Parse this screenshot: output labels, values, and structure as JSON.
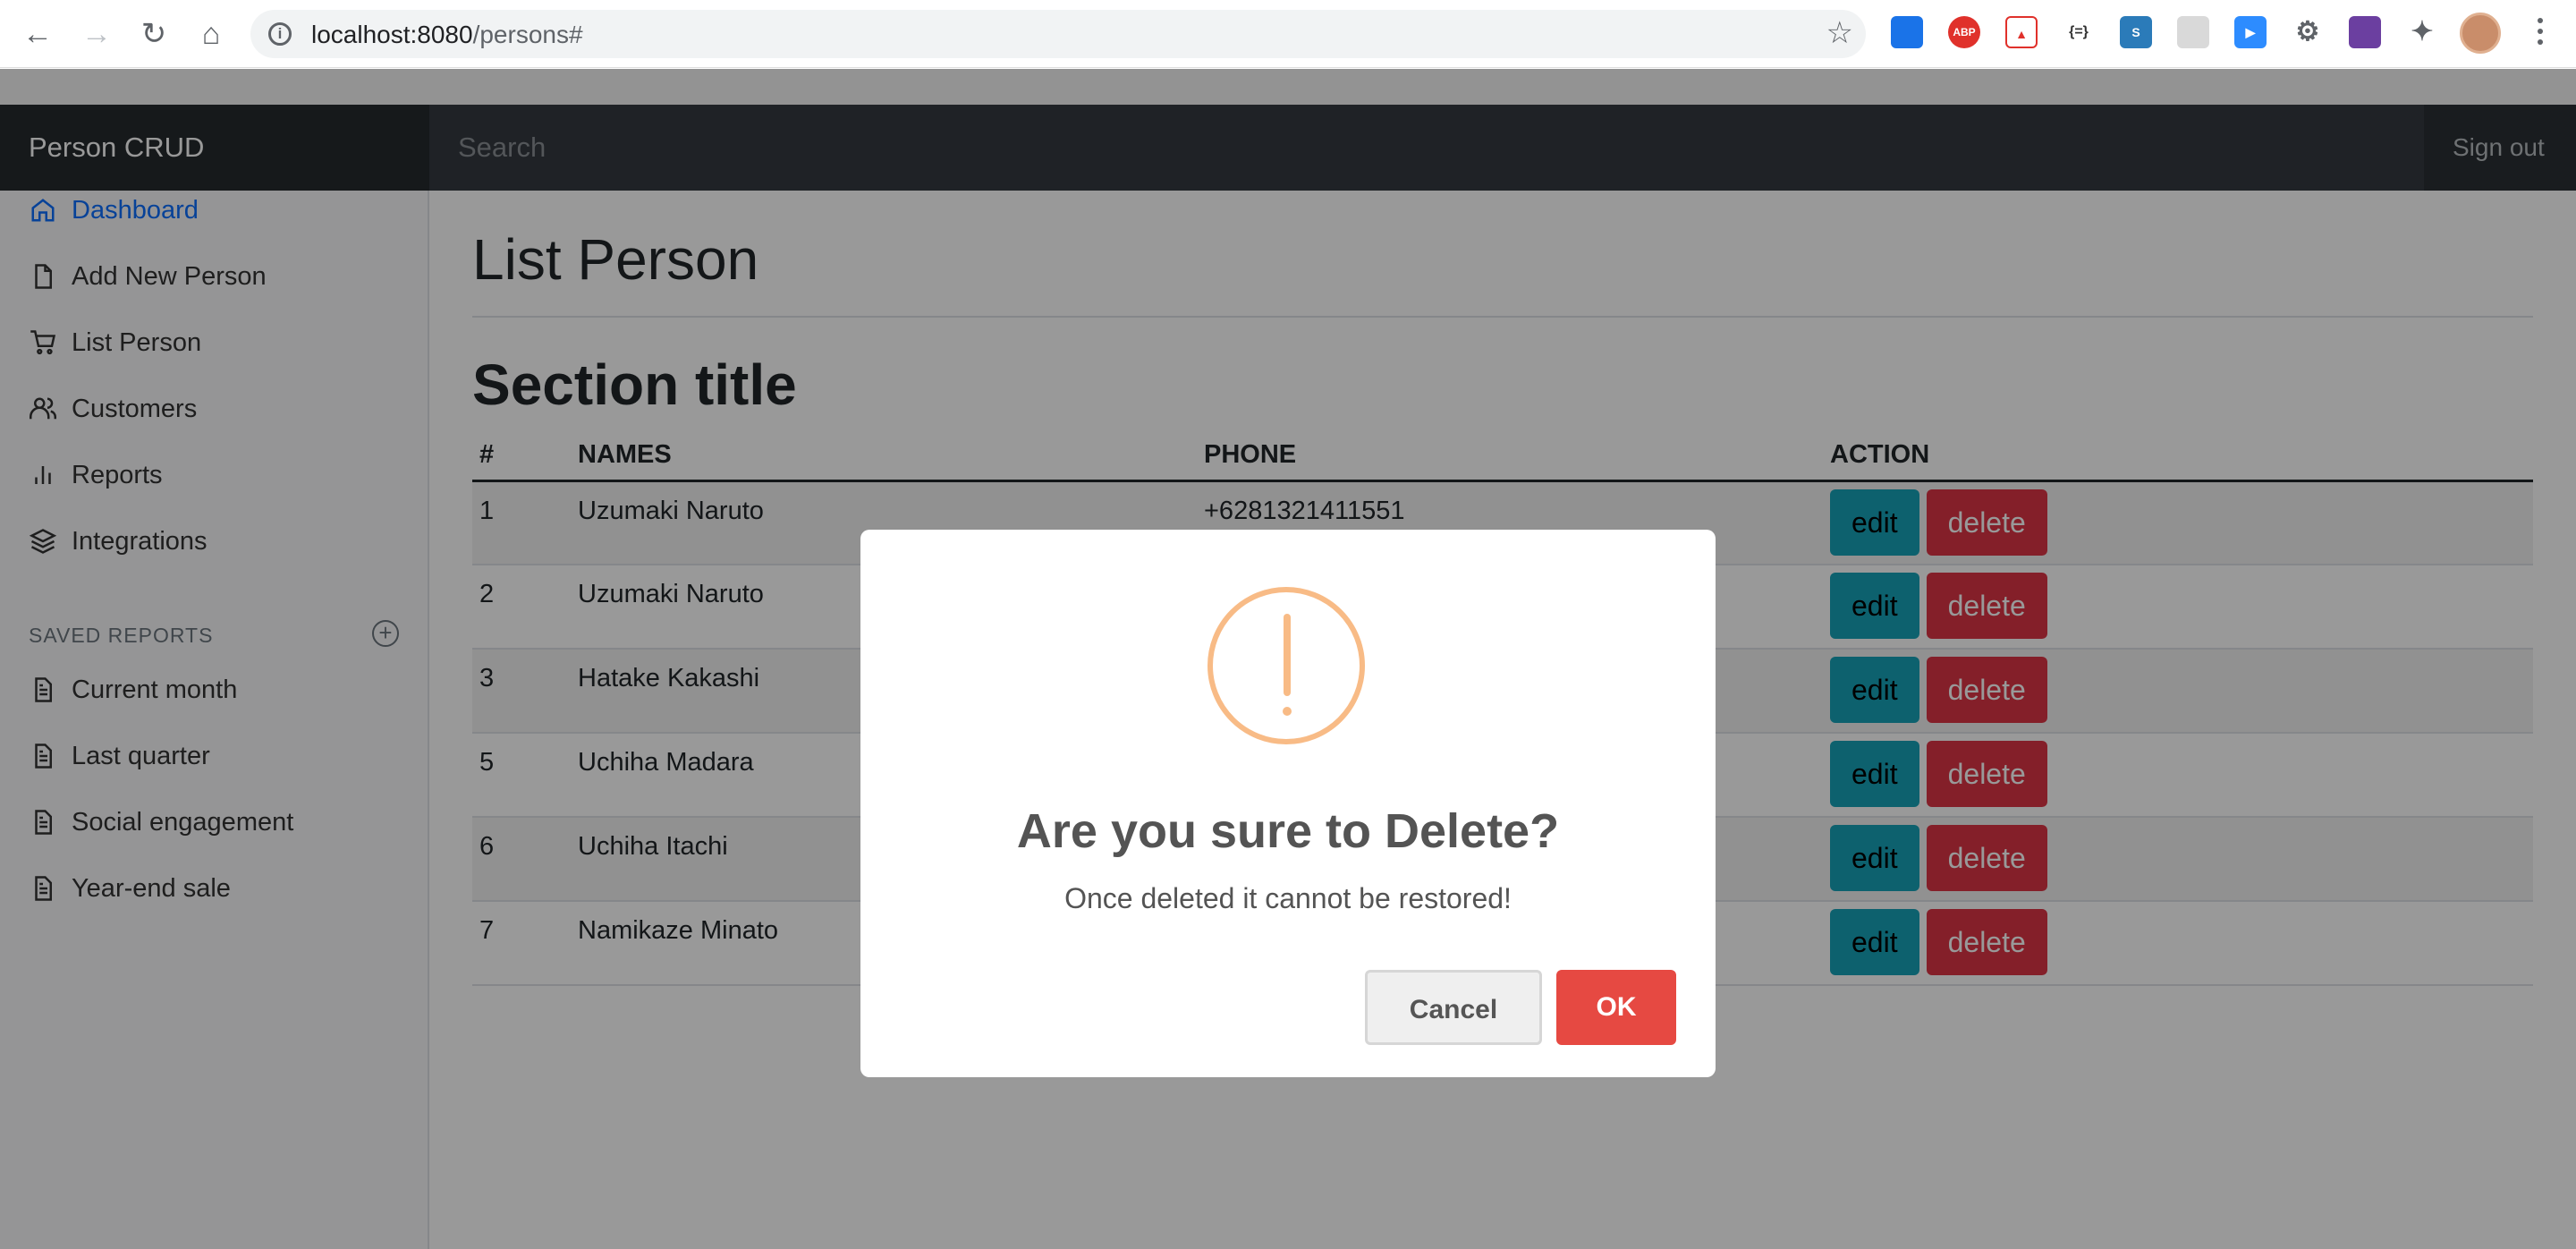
{
  "browser": {
    "url_host": "localhost:8080",
    "url_path": "/persons#"
  },
  "navbar": {
    "brand": "Person CRUD",
    "search_placeholder": "Search",
    "signout": "Sign out"
  },
  "sidebar": {
    "items": [
      {
        "label": "Dashboard",
        "icon": "home-icon",
        "active": true
      },
      {
        "label": "Add New Person",
        "icon": "file-icon"
      },
      {
        "label": "List Person",
        "icon": "cart-icon"
      },
      {
        "label": "Customers",
        "icon": "users-icon"
      },
      {
        "label": "Reports",
        "icon": "bar-chart-icon"
      },
      {
        "label": "Integrations",
        "icon": "layers-icon"
      }
    ],
    "saved_heading": "SAVED REPORTS",
    "saved": [
      {
        "label": "Current month",
        "icon": "file-text-icon"
      },
      {
        "label": "Last quarter",
        "icon": "file-text-icon"
      },
      {
        "label": "Social engagement",
        "icon": "file-text-icon"
      },
      {
        "label": "Year-end sale",
        "icon": "file-text-icon"
      }
    ]
  },
  "main": {
    "title": "List Person",
    "section_title": "Section title",
    "table": {
      "headers": [
        "#",
        "NAMES",
        "PHONE",
        "ACTION"
      ],
      "rows": [
        {
          "id": "1",
          "name": "Uzumaki Naruto",
          "phone": "+6281321411551"
        },
        {
          "id": "2",
          "name": "Uzumaki Naruto",
          "phone": ""
        },
        {
          "id": "3",
          "name": "Hatake Kakashi",
          "phone": ""
        },
        {
          "id": "5",
          "name": "Uchiha Madara",
          "phone": ""
        },
        {
          "id": "6",
          "name": "Uchiha Itachi",
          "phone": ""
        },
        {
          "id": "7",
          "name": "Namikaze Minato",
          "phone": ""
        }
      ],
      "edit_label": "edit",
      "delete_label": "delete"
    }
  },
  "modal": {
    "icon": "warning-icon",
    "title": "Are you sure to Delete?",
    "text": "Once deleted it cannot be restored!",
    "cancel": "Cancel",
    "ok": "OK"
  }
}
